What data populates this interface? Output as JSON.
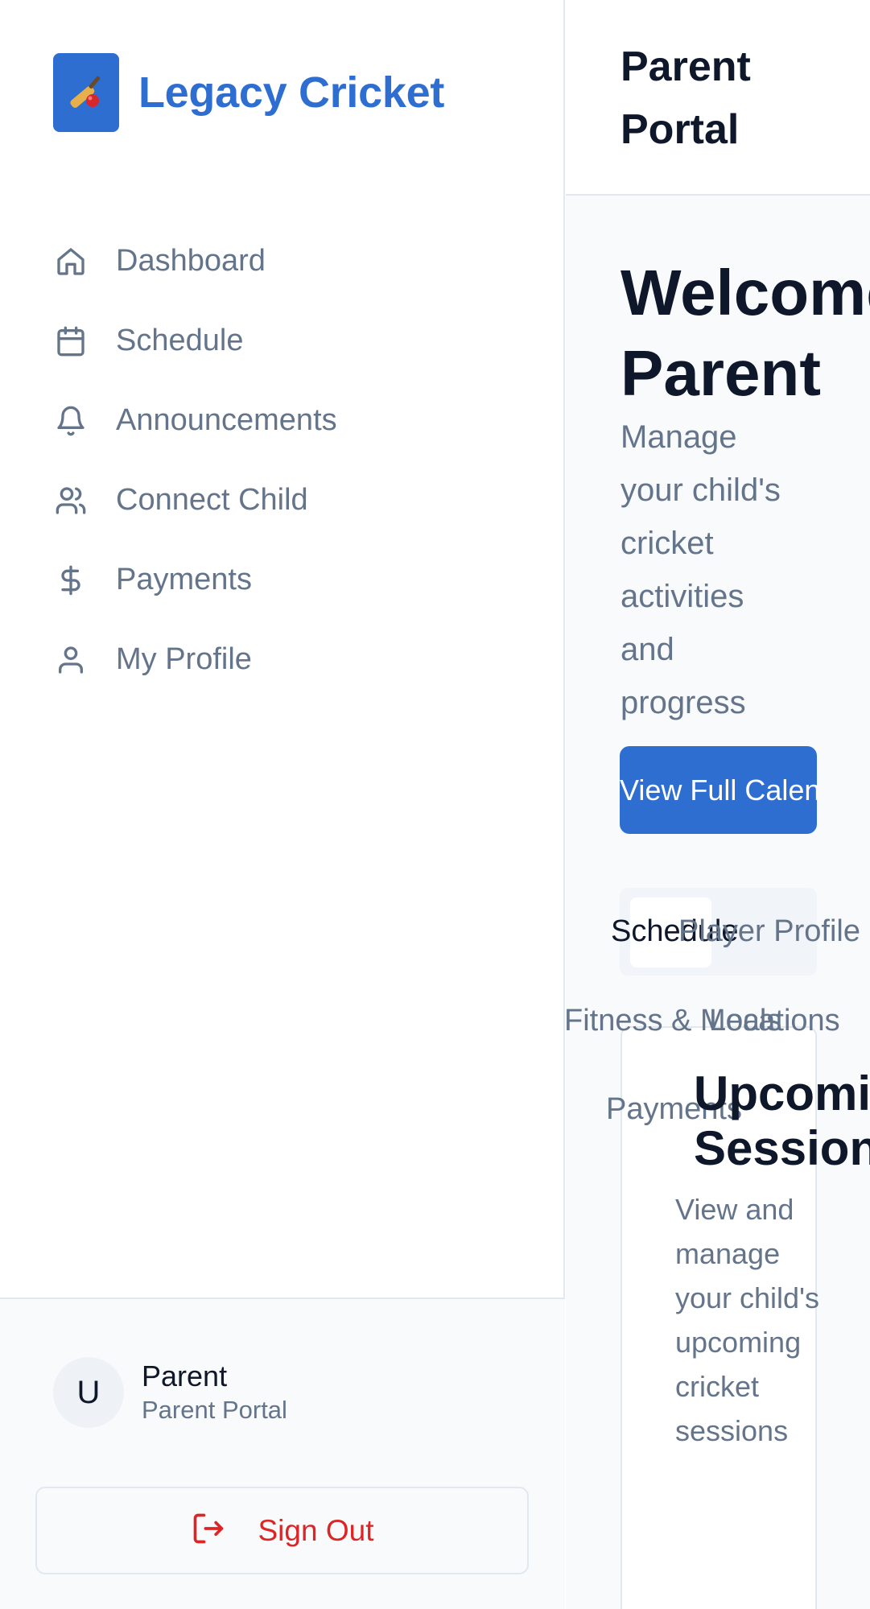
{
  "brand": {
    "name": "Legacy Cricket",
    "logo_icon": "cricket-bat-icon",
    "accent": "#2f6ed1"
  },
  "sidebar": {
    "items": [
      {
        "label": "Dashboard",
        "icon": "home-icon"
      },
      {
        "label": "Schedule",
        "icon": "calendar-icon"
      },
      {
        "label": "Announcements",
        "icon": "bell-icon"
      },
      {
        "label": "Connect Child",
        "icon": "users-icon"
      },
      {
        "label": "Payments",
        "icon": "dollar-icon"
      },
      {
        "label": "My Profile",
        "icon": "user-icon"
      }
    ]
  },
  "user": {
    "initial": "U",
    "name": "Parent",
    "role": "Parent Portal"
  },
  "signout": {
    "label": "Sign Out",
    "color": "#dc2626"
  },
  "header": {
    "title": "Parent Portal"
  },
  "hero": {
    "title": "Welcome,\nParent",
    "subtitle": "Manage your child's cricket activities and progress",
    "button_label": "View Full Calendar"
  },
  "tabs": [
    "Schedule",
    "Player Profile",
    "Fitness & Meals",
    "Locations",
    "Payments"
  ],
  "card": {
    "title": "Upcoming\nSessions",
    "description": "View and manage your child's upcoming cricket sessions"
  }
}
